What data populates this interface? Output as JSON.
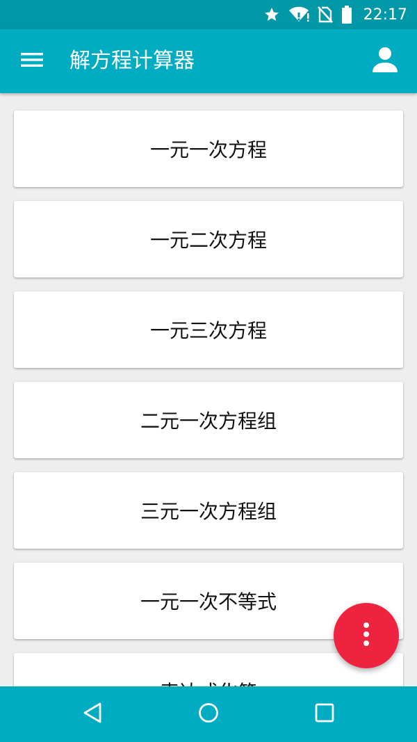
{
  "status_bar": {
    "time": "22:17",
    "icons": [
      "star-icon",
      "wifi-alert-icon",
      "no-sim-icon",
      "battery-icon"
    ]
  },
  "app_bar": {
    "title": "解方程计算器",
    "menu_icon": "menu-icon",
    "account_icon": "account-icon"
  },
  "items": [
    {
      "label": "一元一次方程"
    },
    {
      "label": "一元二次方程"
    },
    {
      "label": "一元三次方程"
    },
    {
      "label": "二元一次方程组"
    },
    {
      "label": "三元一次方程组"
    },
    {
      "label": "一元一次不等式"
    },
    {
      "label": "表达式化简"
    }
  ],
  "fab": {
    "icon": "more-vert-icon"
  },
  "nav_bar": {
    "back_icon": "back-icon",
    "home_icon": "home-icon",
    "recents_icon": "recents-icon"
  },
  "colors": {
    "status_bar": "#0097a7",
    "app_bar": "#00acc1",
    "fab": "#ee2340",
    "background": "#eeeeee"
  }
}
